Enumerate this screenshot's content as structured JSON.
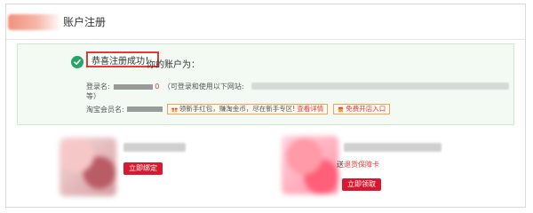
{
  "header": {
    "title": "账户注册"
  },
  "success": {
    "congrats": "恭喜注册成功！",
    "account_text": "你的账户为：",
    "login_label": "登录名:",
    "login_masked_tail": "0",
    "login_note": "（可登录和使用以下网站:",
    "login_wrap": "等）",
    "member_label": "淘宝会员名:",
    "promo_text": "领新手红包，赚淘金币，尽在新手专区!",
    "promo_link": "查看详情",
    "shop_label": "免费开店入口"
  },
  "cards": {
    "left": {
      "button_label": "立即绑定"
    },
    "right": {
      "caption_prefix": "送",
      "caption_red": "退货保障卡",
      "button_label": "立即领取"
    }
  },
  "colors": {
    "accent_red": "#d9172f",
    "success_green": "#2aa36b",
    "panel_bg": "#f3faf3"
  }
}
